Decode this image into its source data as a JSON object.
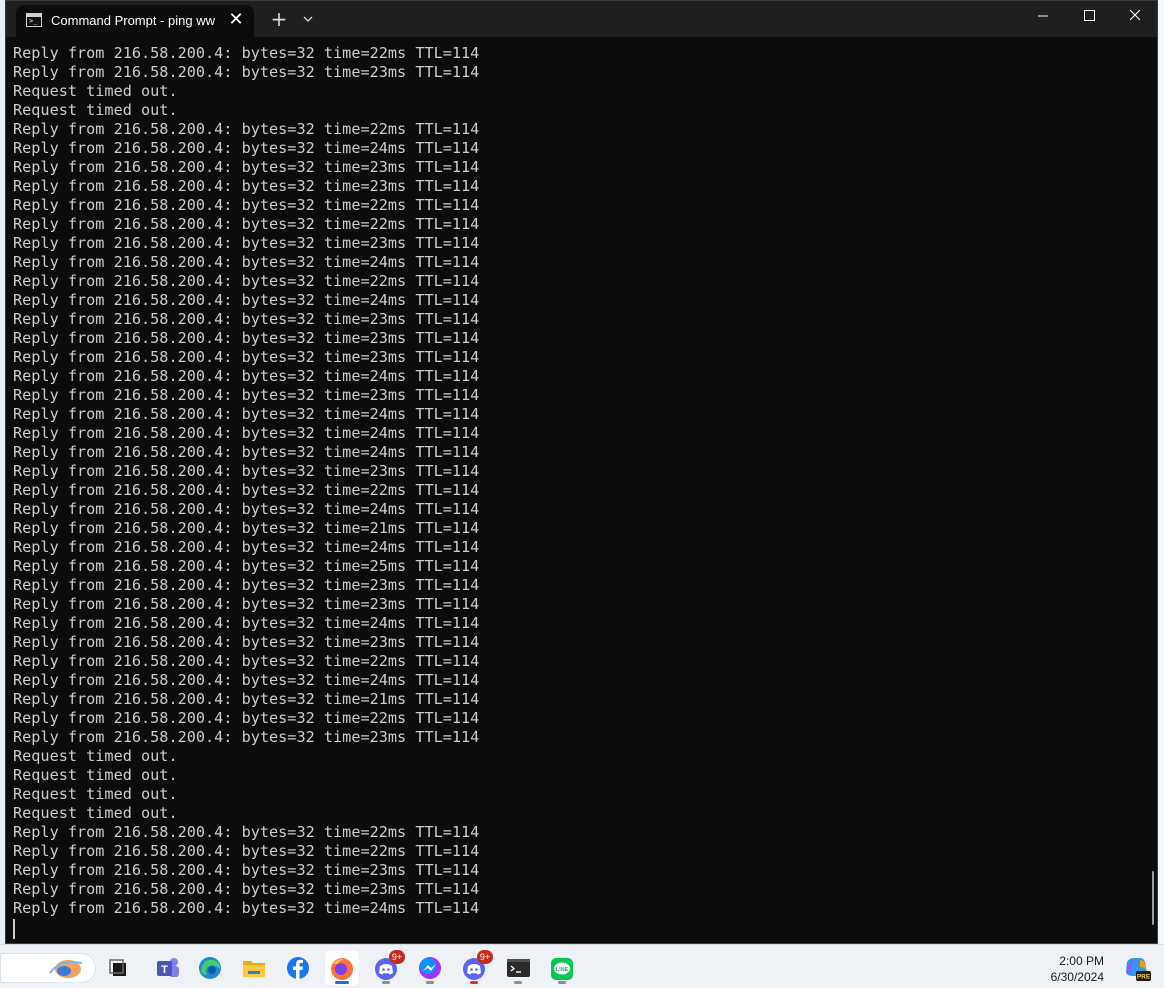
{
  "window": {
    "tab_title": "Command Prompt - ping  ww",
    "tab_icon_glyph": ">_",
    "close_tab_glyph": "✕",
    "new_tab_glyph": "+"
  },
  "console": {
    "lines": [
      "Reply from 216.58.200.4: bytes=32 time=22ms TTL=114",
      "Reply from 216.58.200.4: bytes=32 time=23ms TTL=114",
      "Request timed out.",
      "Request timed out.",
      "Reply from 216.58.200.4: bytes=32 time=22ms TTL=114",
      "Reply from 216.58.200.4: bytes=32 time=24ms TTL=114",
      "Reply from 216.58.200.4: bytes=32 time=23ms TTL=114",
      "Reply from 216.58.200.4: bytes=32 time=23ms TTL=114",
      "Reply from 216.58.200.4: bytes=32 time=22ms TTL=114",
      "Reply from 216.58.200.4: bytes=32 time=22ms TTL=114",
      "Reply from 216.58.200.4: bytes=32 time=23ms TTL=114",
      "Reply from 216.58.200.4: bytes=32 time=24ms TTL=114",
      "Reply from 216.58.200.4: bytes=32 time=22ms TTL=114",
      "Reply from 216.58.200.4: bytes=32 time=24ms TTL=114",
      "Reply from 216.58.200.4: bytes=32 time=23ms TTL=114",
      "Reply from 216.58.200.4: bytes=32 time=23ms TTL=114",
      "Reply from 216.58.200.4: bytes=32 time=23ms TTL=114",
      "Reply from 216.58.200.4: bytes=32 time=24ms TTL=114",
      "Reply from 216.58.200.4: bytes=32 time=23ms TTL=114",
      "Reply from 216.58.200.4: bytes=32 time=24ms TTL=114",
      "Reply from 216.58.200.4: bytes=32 time=24ms TTL=114",
      "Reply from 216.58.200.4: bytes=32 time=24ms TTL=114",
      "Reply from 216.58.200.4: bytes=32 time=23ms TTL=114",
      "Reply from 216.58.200.4: bytes=32 time=22ms TTL=114",
      "Reply from 216.58.200.4: bytes=32 time=24ms TTL=114",
      "Reply from 216.58.200.4: bytes=32 time=21ms TTL=114",
      "Reply from 216.58.200.4: bytes=32 time=24ms TTL=114",
      "Reply from 216.58.200.4: bytes=32 time=25ms TTL=114",
      "Reply from 216.58.200.4: bytes=32 time=23ms TTL=114",
      "Reply from 216.58.200.4: bytes=32 time=23ms TTL=114",
      "Reply from 216.58.200.4: bytes=32 time=24ms TTL=114",
      "Reply from 216.58.200.4: bytes=32 time=23ms TTL=114",
      "Reply from 216.58.200.4: bytes=32 time=22ms TTL=114",
      "Reply from 216.58.200.4: bytes=32 time=24ms TTL=114",
      "Reply from 216.58.200.4: bytes=32 time=21ms TTL=114",
      "Reply from 216.58.200.4: bytes=32 time=22ms TTL=114",
      "Reply from 216.58.200.4: bytes=32 time=23ms TTL=114",
      "Request timed out.",
      "Request timed out.",
      "Request timed out.",
      "Request timed out.",
      "Reply from 216.58.200.4: bytes=32 time=22ms TTL=114",
      "Reply from 216.58.200.4: bytes=32 time=22ms TTL=114",
      "Reply from 216.58.200.4: bytes=32 time=23ms TTL=114",
      "Reply from 216.58.200.4: bytes=32 time=23ms TTL=114",
      "Reply from 216.58.200.4: bytes=32 time=24ms TTL=114"
    ]
  },
  "taskbar": {
    "items": [
      {
        "name": "search-box",
        "icon": "search-highlight-icon"
      },
      {
        "name": "task-view",
        "icon": "task-view-icon"
      },
      {
        "name": "teams",
        "icon": "teams-icon"
      },
      {
        "name": "edge",
        "icon": "edge-icon"
      },
      {
        "name": "file-explorer",
        "icon": "folder-icon"
      },
      {
        "name": "facebook",
        "icon": "facebook-icon"
      },
      {
        "name": "firefox",
        "icon": "firefox-icon",
        "active": true
      },
      {
        "name": "discord",
        "icon": "discord-icon",
        "badge": "9+"
      },
      {
        "name": "messenger",
        "icon": "messenger-icon"
      },
      {
        "name": "discord-2",
        "icon": "discord-icon",
        "badge": "9+"
      },
      {
        "name": "terminal",
        "icon": "terminal-icon"
      },
      {
        "name": "line",
        "icon": "line-icon",
        "label": "LINE"
      }
    ],
    "clock": {
      "time": "2:00 PM",
      "date": "6/30/2024"
    },
    "copilot_badge": "PRE"
  },
  "colors": {
    "console_bg": "#0c0c0c",
    "console_fg": "#cccccc",
    "titlebar_bg": "#1f1f1f",
    "taskbar_bg": "#eef1f5",
    "active_indicator": "#1f6fd1"
  }
}
